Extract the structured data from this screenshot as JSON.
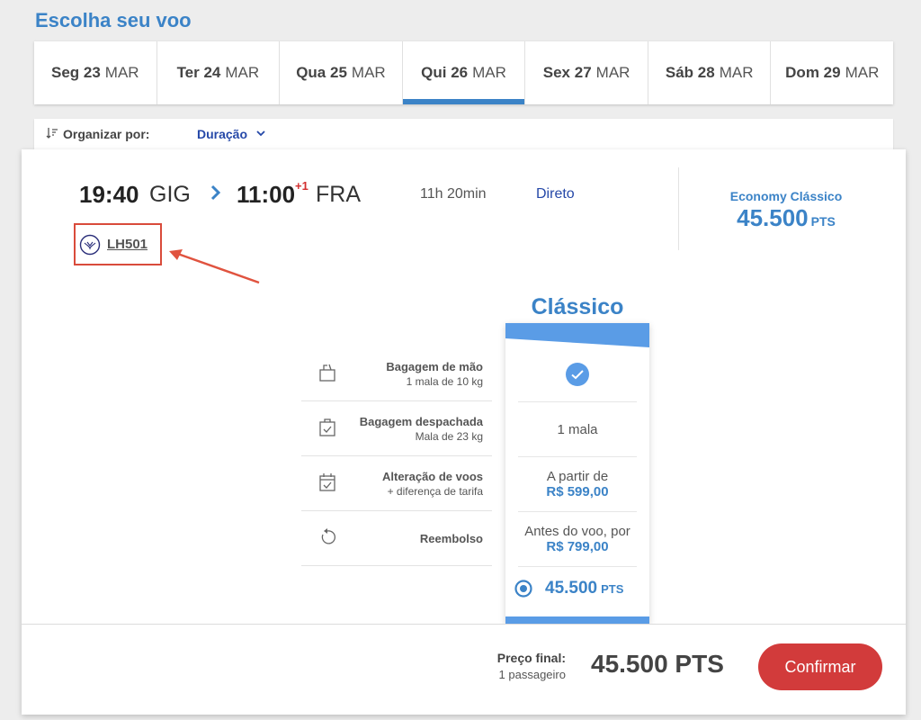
{
  "header": {
    "title": "Escolha seu voo"
  },
  "date_tabs": [
    {
      "day": "Seg 23",
      "month": "MAR",
      "active": false
    },
    {
      "day": "Ter 24",
      "month": "MAR",
      "active": false
    },
    {
      "day": "Qua 25",
      "month": "MAR",
      "active": false
    },
    {
      "day": "Qui 26",
      "month": "MAR",
      "active": true
    },
    {
      "day": "Sex 27",
      "month": "MAR",
      "active": false
    },
    {
      "day": "Sáb 28",
      "month": "MAR",
      "active": false
    },
    {
      "day": "Dom 29",
      "month": "MAR",
      "active": false
    }
  ],
  "sort": {
    "label": "Organizar por:",
    "value": "Duração"
  },
  "flight": {
    "departure_time": "19:40",
    "departure_code": "GIG",
    "arrival_time": "11:00",
    "arrival_day_offset": "+1",
    "arrival_code": "FRA",
    "duration": "11h 20min",
    "stops": "Direto",
    "flight_number": "LH501",
    "cabin_label": "Economy Clássico",
    "cabin_price": "45.500",
    "cabin_price_unit": "PTS"
  },
  "fare": {
    "title": "Clássico",
    "features": [
      {
        "title": "Bagagem de mão",
        "subtitle": "1 mala de 10 kg",
        "icon": "carry-on-bag-icon"
      },
      {
        "title": "Bagagem despachada",
        "subtitle": "Mala de 23 kg",
        "icon": "checked-bag-icon"
      },
      {
        "title": "Alteração de voos",
        "subtitle": "+ diferença de tarifa",
        "icon": "calendar-change-icon"
      },
      {
        "title": "Reembolso",
        "subtitle": "",
        "icon": "refund-icon"
      }
    ],
    "values": {
      "carry_on": "",
      "checked": "1 mala",
      "change_line1": "A partir de",
      "change_price": "R$ 599,00",
      "refund_line1": "Antes do voo, por",
      "refund_price": "R$ 799,00"
    },
    "select_price": "45.500",
    "select_unit": "PTS"
  },
  "footer": {
    "final_label": "Preço final:",
    "passengers": "1 passageiro",
    "total": "45.500 PTS",
    "confirm_label": "Confirmar"
  },
  "colors": {
    "accent": "#3b83c7",
    "link": "#2548a8",
    "confirm": "#d23b3b",
    "highlight": "#d94b3b"
  }
}
